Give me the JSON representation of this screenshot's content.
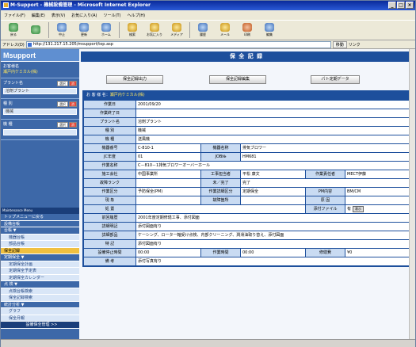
{
  "window": {
    "title": "M-Support - 機械設備管理 - Microsoft Internet Explorer"
  },
  "menu": [
    "ファイル(F)",
    "編集(E)",
    "表示(V)",
    "お気に入り(A)",
    "ツール(T)",
    "ヘルプ(H)"
  ],
  "toolbar": [
    {
      "label": "戻る",
      "color": "green"
    },
    {
      "label": "",
      "color": "green"
    },
    {
      "label": "中止",
      "color": "blue"
    },
    {
      "label": "更新",
      "color": "blue"
    },
    {
      "label": "ホーム",
      "color": "blue"
    },
    {
      "label": "検索",
      "color": "yellow"
    },
    {
      "label": "お気に入り",
      "color": "yellow"
    },
    {
      "label": "メディア",
      "color": "yellow"
    },
    {
      "label": "履歴",
      "color": "blue"
    },
    {
      "label": "メール",
      "color": "yellow"
    },
    {
      "label": "印刷",
      "color": "red"
    },
    {
      "label": "編集",
      "color": "blue"
    }
  ],
  "address": {
    "label": "アドレス(D)",
    "url": "http://131.217.15.205/msupport/top.asp",
    "go": "移動",
    "links": "リンク"
  },
  "sidebar": {
    "logo": "Msupport",
    "customer_label": "お客様名",
    "customer_value": "瀬戸内ケミカル(株)",
    "plant_label": "プラント名",
    "plant_select": "選択",
    "plant_clear": "消",
    "plant_value": "溶剤プラント",
    "category_label": "種 別",
    "category_select": "選択",
    "category_clear": "消",
    "category_value": "機械",
    "kind_label": "機 種",
    "kind_select": "選択",
    "kind_clear": "消",
    "nav_head": "Maintenance Menu",
    "items": [
      {
        "label": "トップメニューに戻る",
        "type": "h"
      },
      {
        "label": "設備台帳",
        "type": "h"
      },
      {
        "label": "台帳 ▼",
        "type": "h"
      },
      {
        "label": "機器台帳",
        "type": "s"
      },
      {
        "label": "部品台帳",
        "type": "s"
      },
      {
        "label": "保全記録",
        "type": "act"
      },
      {
        "label": "定期保全 ▼",
        "type": "h"
      },
      {
        "label": "定期保全計画",
        "type": "s"
      },
      {
        "label": "定期保全予定表",
        "type": "s"
      },
      {
        "label": "定期保全カレンダー",
        "type": "s"
      },
      {
        "label": "点 検 ▼",
        "type": "h"
      },
      {
        "label": "点検台帳検索",
        "type": "s"
      },
      {
        "label": "保全記録検索",
        "type": "s"
      },
      {
        "label": "統計分析 ▼",
        "type": "h"
      },
      {
        "label": "グラフ",
        "type": "s"
      },
      {
        "label": "保全月報",
        "type": "s"
      },
      {
        "label": "設備保全管理 >>",
        "type": "foot"
      }
    ]
  },
  "page": {
    "title": "保 全 記 録",
    "buttons": {
      "output": "保全記録出力",
      "edit": "保全記録編集",
      "data": "パト定期データ"
    },
    "customer_label": "お 客 様 名",
    "customer_value": "瀬戸内ケミカル(株)",
    "rows": [
      [
        "作業日",
        "2001/09/20"
      ],
      [
        "作業終了日",
        ""
      ],
      [
        "プラント名",
        "溶剤プラント"
      ],
      [
        "種 別",
        "機械"
      ],
      [
        "機 種",
        "送風機"
      ],
      [
        "機器番号",
        "C-810-1",
        "機器名称",
        "排気ブロワー"
      ],
      [
        "JC年度",
        "01",
        "JOB№",
        "HM681"
      ],
      [
        "作業名称",
        "C－810－1排気ブロワーオーバーホール"
      ],
      [
        "施工会社",
        "中国事業所",
        "工事担当者",
        "平松 康文",
        "作業責任者",
        "MECT伊藤"
      ],
      [
        "故障ランク",
        "",
        "未／完了",
        "完了"
      ],
      [
        "作業区分",
        "予防保全(PM)",
        "作業詳細区分",
        "定期保全",
        "PM内容",
        "BM/CM"
      ],
      [
        "現 象",
        "",
        "故障箇所",
        "",
        "原 因",
        ""
      ],
      [
        "処 置",
        "",
        "",
        "",
        "添付ファイル",
        "有",
        "表示"
      ],
      [
        "前回履歴",
        "2001年度定期修繕工事、添付図面"
      ],
      [
        "詳細明記",
        "添付図面有り"
      ],
      [
        "詳細部品",
        "ケーシング、ローター軸受け点検、内部クリーニング、潤滑油取り替え、添付図面"
      ],
      [
        "特 記",
        "添付図面有り"
      ],
      [
        "設備停止時間",
        "00:00",
        "作業時間",
        "00:00",
        "修繕費",
        "¥0"
      ],
      [
        "備 考",
        "添付写真有り"
      ]
    ]
  }
}
